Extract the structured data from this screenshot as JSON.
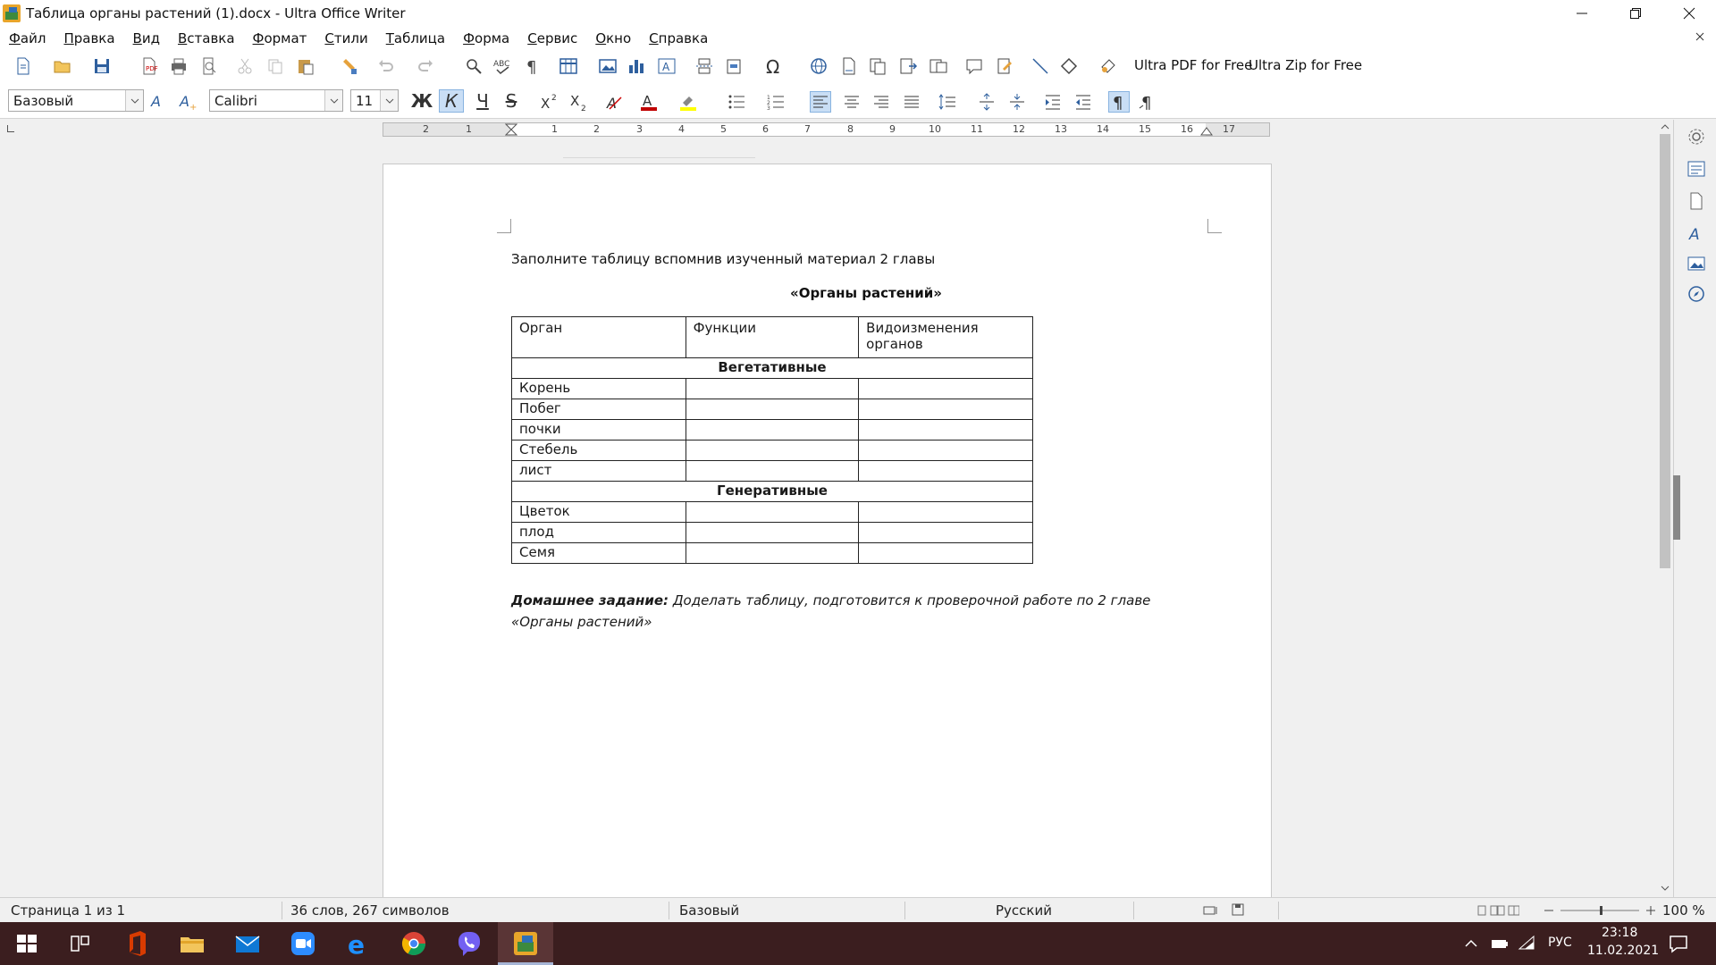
{
  "window": {
    "title": "Таблица органы растений (1).docx - Ultra Office Writer"
  },
  "menu": [
    "Файл",
    "Правка",
    "Вид",
    "Вставка",
    "Формат",
    "Стили",
    "Таблица",
    "Форма",
    "Сервис",
    "Окно",
    "Справка"
  ],
  "toolbar": {
    "ultra_pdf_label": "Ultra PDF for Free",
    "ultra_zip_label": "Ultra Zip for Free",
    "paragraph_style": "Базовый",
    "font_name": "Calibri",
    "font_size": "11",
    "bold_label": "Ж",
    "italic_label": "К",
    "underline_label": "Ч",
    "strike_label": "S"
  },
  "ruler": {
    "labels": [
      "2",
      "1",
      "1",
      "2",
      "3",
      "4",
      "5",
      "6",
      "7",
      "8",
      "9",
      "10",
      "11",
      "12",
      "13",
      "14",
      "15",
      "16",
      "17"
    ]
  },
  "document": {
    "instruction": "Заполните таблицу вспомнив изученный материал 2 главы",
    "heading": "«Органы растений»",
    "table": {
      "headers": [
        "Орган",
        "Функции",
        "Видоизменения органов"
      ],
      "section_vegetative": "Вегетативные",
      "vegetative_rows": [
        "Корень",
        "Побег",
        "почки",
        "Стебель",
        "лист"
      ],
      "section_generative": "Генеративные",
      "generative_rows": [
        "Цветок",
        "плод",
        "Семя"
      ]
    },
    "homework_label": "Домашнее задание:",
    "homework_text": "Доделать таблицу, подготовится к проверочной работе по 2 главе «Органы растений»"
  },
  "status": {
    "page": "Страница 1 из 1",
    "words": "36 слов, 267 символов",
    "style": "Базовый",
    "language": "Русский",
    "zoom": "100 %"
  },
  "taskbar": {
    "lang": "РУС",
    "time": "23:18",
    "date": "11.02.2021"
  }
}
